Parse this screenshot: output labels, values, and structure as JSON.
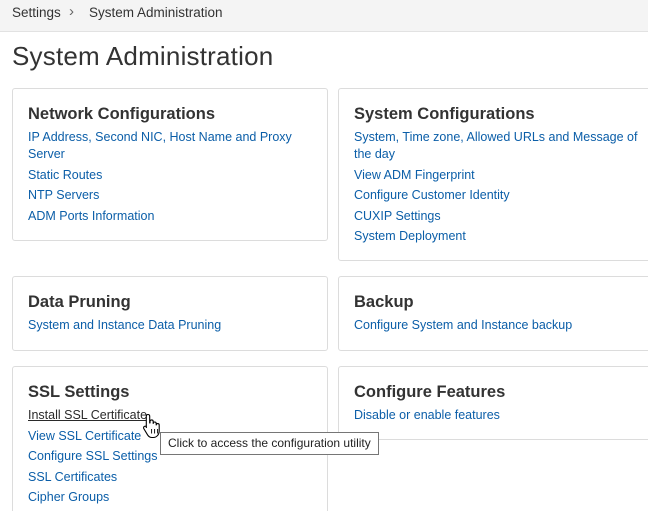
{
  "breadcrumb": {
    "parent": "Settings",
    "separator_icon": "chevron-right-icon",
    "current": "System Administration"
  },
  "page": {
    "title": "System Administration"
  },
  "cards": {
    "network": {
      "title": "Network Configurations",
      "links": [
        "IP Address, Second NIC, Host Name and Proxy Server",
        "Static Routes",
        "NTP Servers",
        "ADM Ports Information"
      ]
    },
    "system": {
      "title": "System Configurations",
      "links": [
        "System, Time zone, Allowed URLs and Message of the day",
        "View ADM Fingerprint",
        "Configure Customer Identity",
        "CUXIP Settings",
        "System Deployment"
      ]
    },
    "pruning": {
      "title": "Data Pruning",
      "links": [
        "System and Instance Data Pruning"
      ]
    },
    "backup": {
      "title": "Backup",
      "links": [
        "Configure System and Instance backup"
      ]
    },
    "ssl": {
      "title": "SSL Settings",
      "links": [
        "Install SSL Certificate",
        "View SSL Certificate",
        "Configure SSL Settings",
        "SSL Certificates",
        "Cipher Groups"
      ]
    },
    "features": {
      "title": "Configure Features",
      "links": [
        "Disable or enable features"
      ]
    }
  },
  "tooltip": {
    "text": "Click to access the configuration utility"
  },
  "cursor": {
    "icon": "hand-pointer-icon"
  },
  "colors": {
    "link": "#0b5ea8",
    "text": "#333333",
    "border": "#dcdcdc",
    "breadcrumb_bg": "#f4f4f4"
  }
}
